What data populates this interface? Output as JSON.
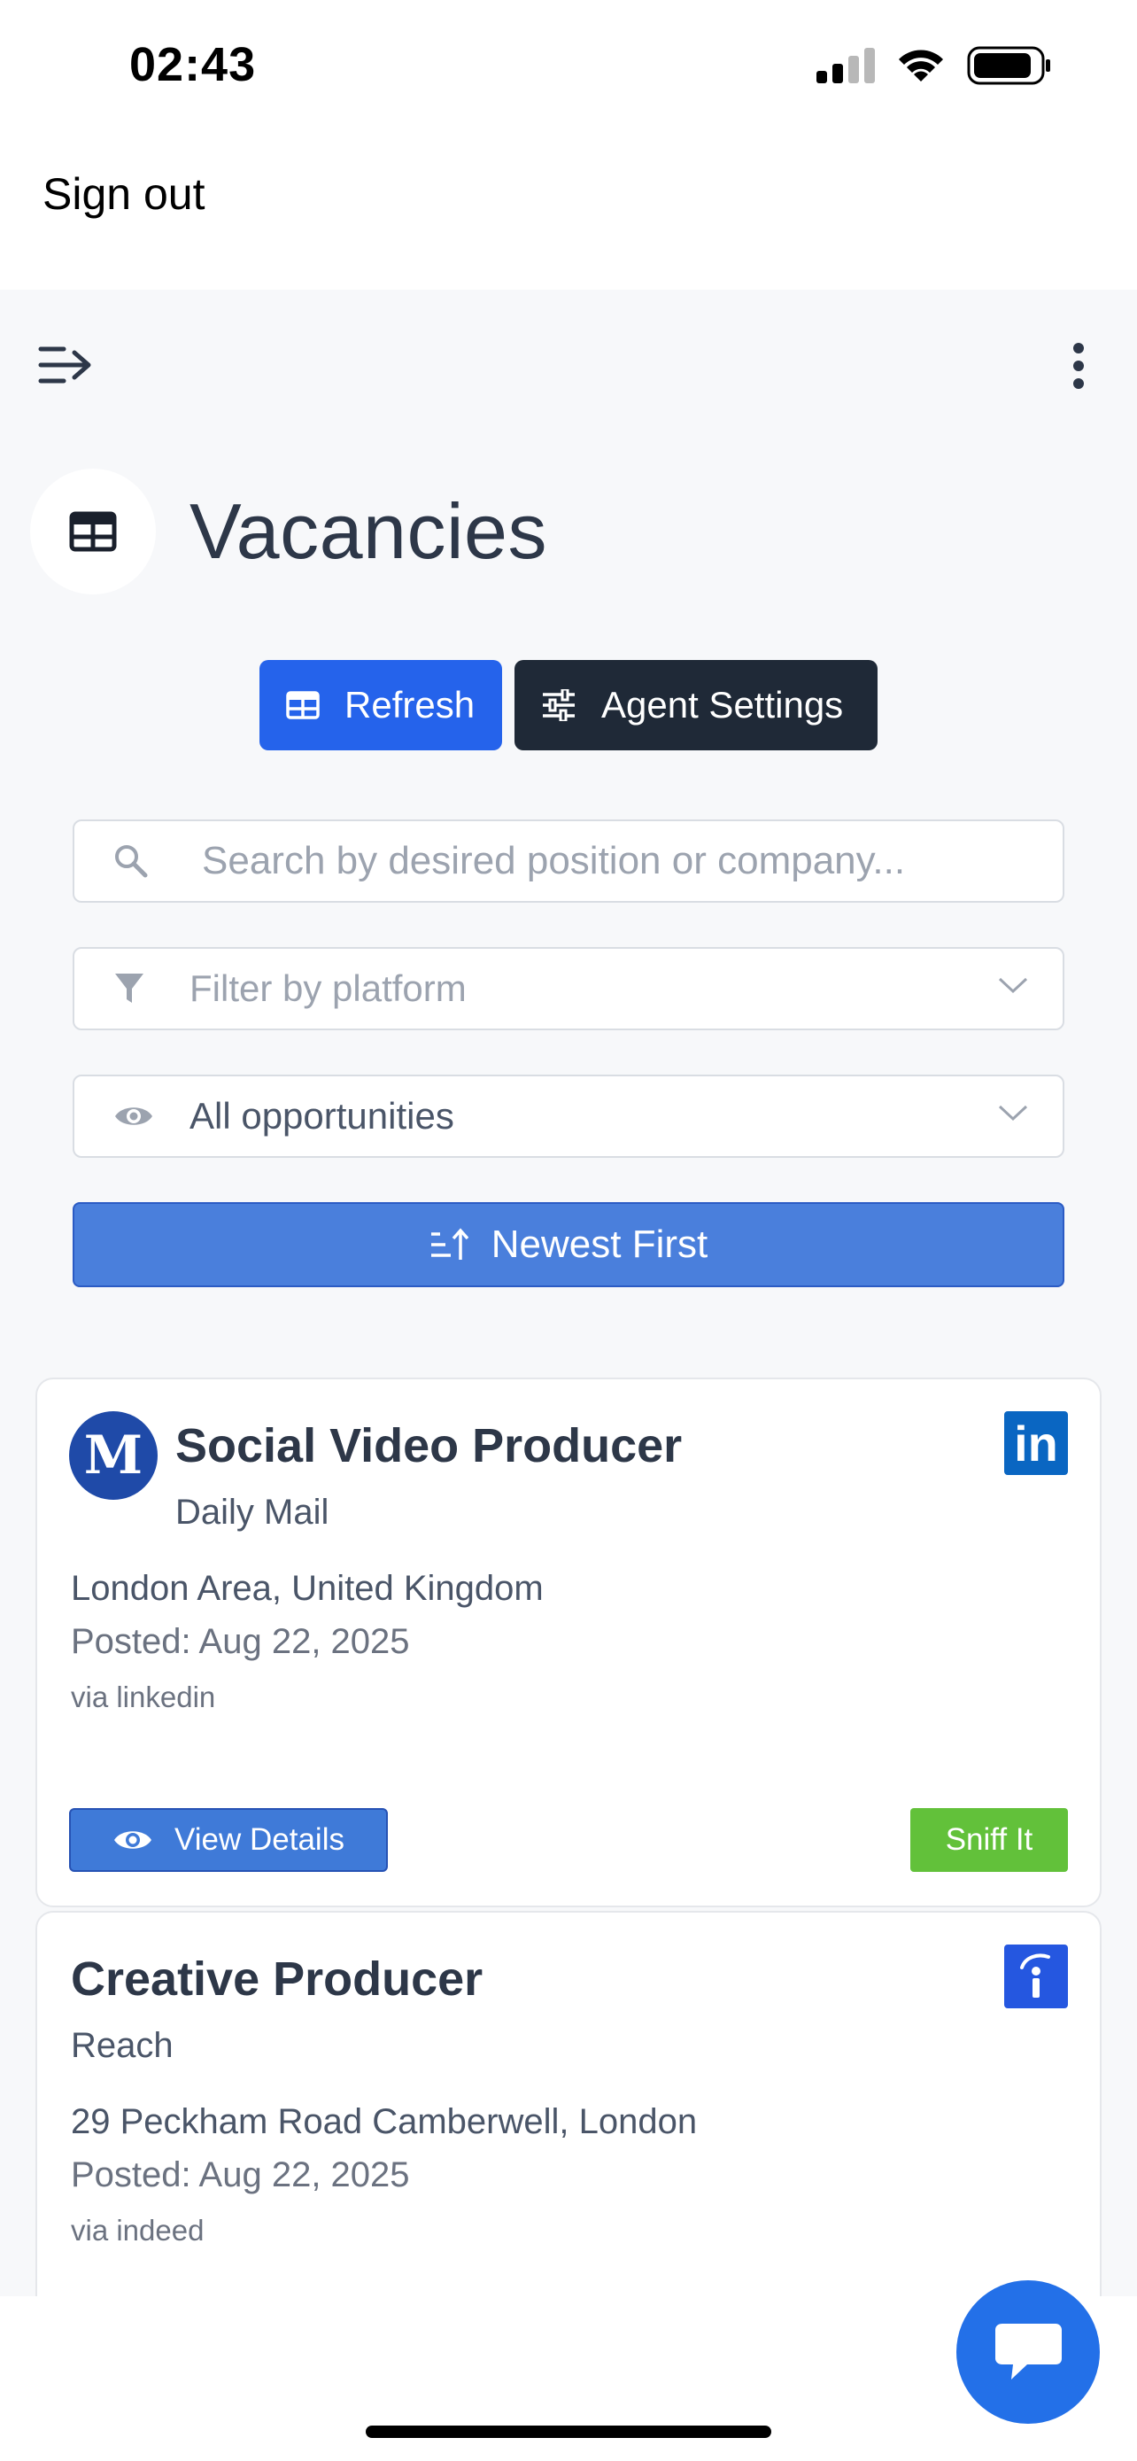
{
  "status_bar": {
    "time": "02:43"
  },
  "auth": {
    "signout_label": "Sign out"
  },
  "page": {
    "title": "Vacancies"
  },
  "actions": {
    "refresh_label": "Refresh",
    "agent_settings_label": "Agent Settings"
  },
  "filters": {
    "search_placeholder": "Search by desired position or company...",
    "platform_placeholder": "Filter by platform",
    "opportunity_value": "All opportunities",
    "sort_label": "Newest First"
  },
  "vacancies": [
    {
      "title": "Social Video Producer",
      "company": "Daily Mail",
      "company_logo_text": "M",
      "location": "London Area, United Kingdom",
      "posted": "Posted: Aug 22, 2025",
      "via": "via linkedin",
      "platform_icon": "linkedin-icon",
      "view_label": "View Details",
      "sniff_label": "Sniff It"
    },
    {
      "title": "Creative Producer",
      "company": "Reach",
      "location": "29 Peckham Road Camberwell, London",
      "posted": "Posted: Aug 22, 2025",
      "via": "via indeed",
      "platform_icon": "indeed-icon"
    }
  ],
  "colors": {
    "primary": "#2563eb",
    "dark": "#1f2937",
    "sort": "#4a7fdc",
    "sniff": "#62c13a",
    "linkedin": "#0a66c2",
    "indeed": "#2557e0",
    "chat_fab": "#2370e8"
  }
}
